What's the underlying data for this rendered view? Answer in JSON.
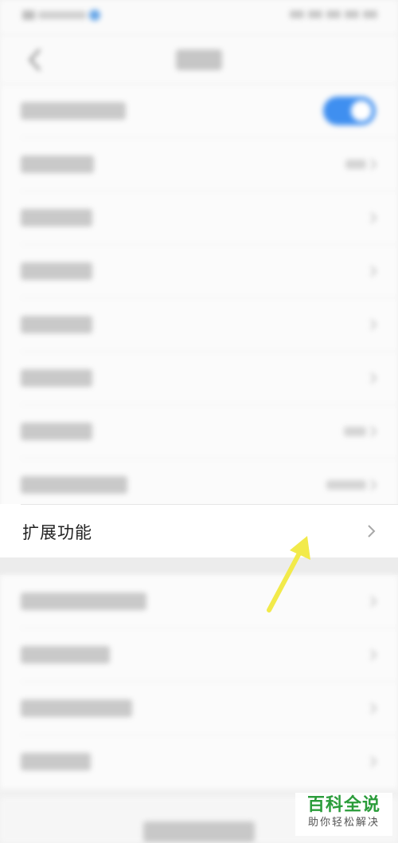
{
  "main": {
    "highlighted_item": {
      "label": "扩展功能"
    }
  },
  "toggle": {
    "state": "on"
  },
  "colors": {
    "accent_toggle": "#3f8ff0",
    "arrow": "#f2ea4a",
    "watermark_green": "#2a9c3a"
  },
  "watermark": {
    "title": "百科全说",
    "subtitle": "助你轻松解决"
  },
  "icons": {
    "back": "back-chevron-icon",
    "row_chevron": "chevron-right-icon",
    "annotation": "annotation-arrow"
  }
}
